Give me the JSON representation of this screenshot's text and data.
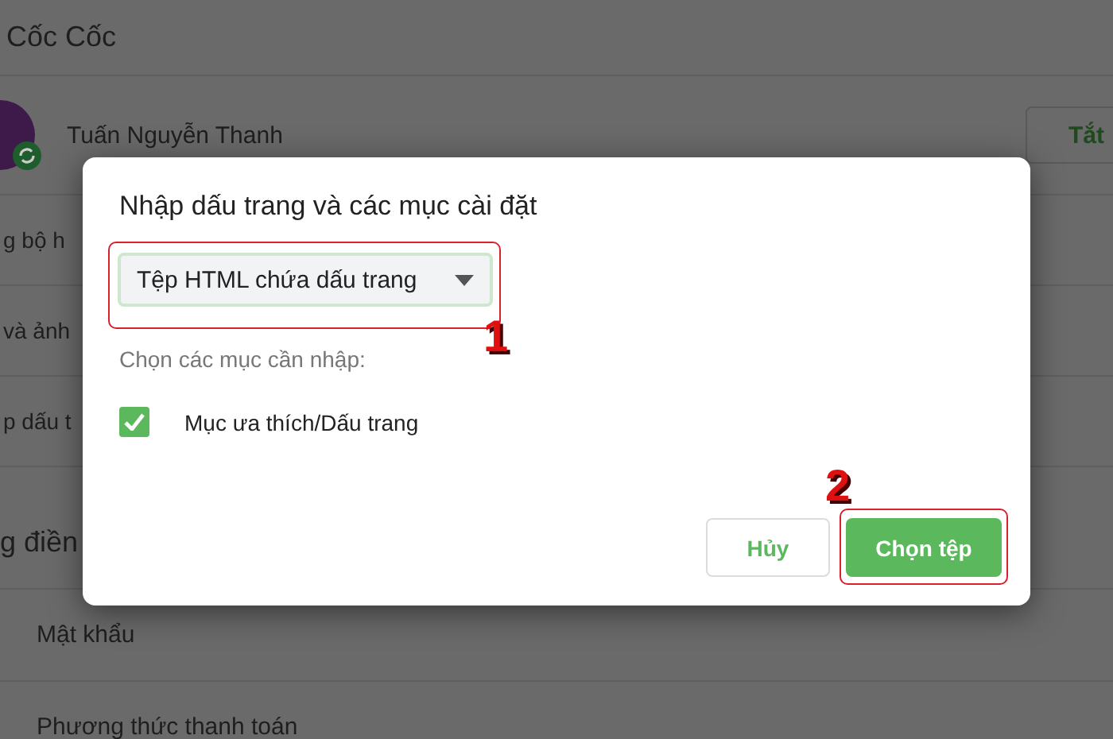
{
  "background": {
    "header": "Cốc Cốc",
    "profile": {
      "name": "Tuấn Nguyễn Thanh",
      "button": "Tắt"
    },
    "rows": [
      "g bộ h",
      "và ảnh",
      "p dấu t"
    ],
    "section": "g điền",
    "section_rows": [
      "Mật khẩu",
      "Phương thức thanh toán"
    ]
  },
  "dialog": {
    "title": "Nhập dấu trang và các mục cài đặt",
    "dropdown": {
      "value": "Tệp HTML chứa dấu trang"
    },
    "prompt": "Chọn các mục cần nhập:",
    "options": [
      {
        "label": "Mục ưa thích/Dấu trang",
        "checked": true
      }
    ],
    "buttons": [
      {
        "label": "Hủy",
        "kind": "secondary"
      },
      {
        "label": "Chọn tệp",
        "kind": "primary"
      }
    ]
  },
  "annotations": [
    "1",
    "2"
  ]
}
